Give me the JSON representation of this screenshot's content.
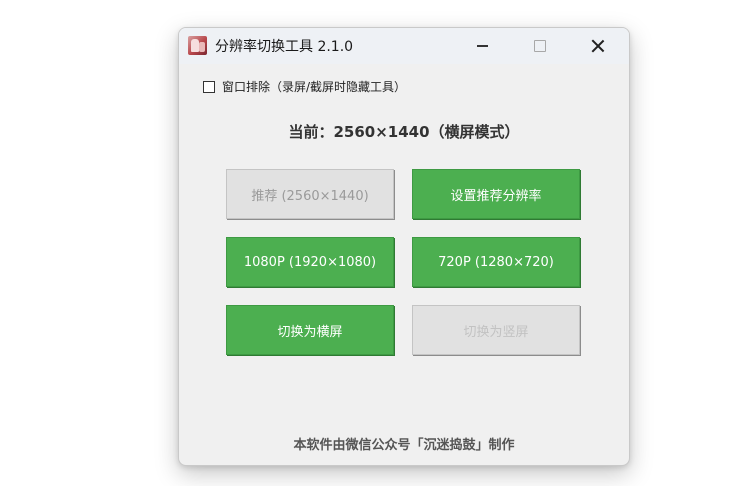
{
  "window": {
    "title": "分辨率切换工具 2.1.0"
  },
  "options": {
    "exclude_window_label": "窗口排除（录屏/截屏时隐藏工具）",
    "exclude_window_checked": false
  },
  "status": {
    "current_text": "当前：2560×1440（横屏模式）"
  },
  "buttons": {
    "recommended_label": "推荐 (2560×1440)",
    "set_recommended_label": "设置推荐分辨率",
    "p1080_label": "1080P (1920×1080)",
    "p720_label": "720P (1280×720)",
    "landscape_label": "切换为横屏",
    "portrait_label": "切换为竖屏"
  },
  "footer": {
    "text": "本软件由微信公众号「沉迷捣鼓」制作"
  },
  "colors": {
    "accent_green": "#4caf50",
    "disabled_gray": "#e1e1e1"
  },
  "icons": {
    "app": "app-icon",
    "minimize": "minimize-icon",
    "maximize": "maximize-icon",
    "close": "close-icon"
  }
}
